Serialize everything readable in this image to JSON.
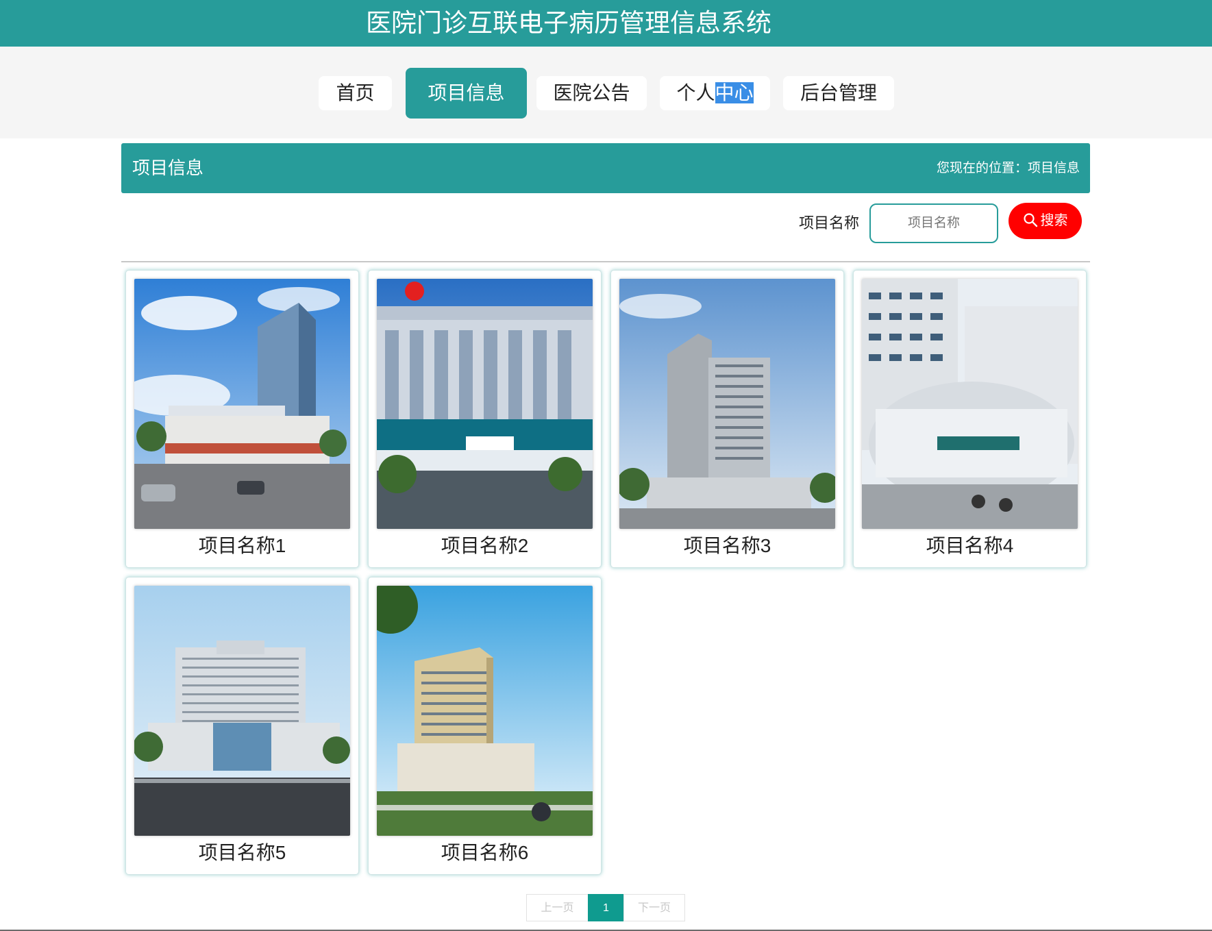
{
  "header": {
    "title": "医院门诊互联电子病历管理信息系统"
  },
  "nav": {
    "items": [
      {
        "label": "首页"
      },
      {
        "label": "项目信息"
      },
      {
        "label": "医院公告"
      },
      {
        "label": "个人",
        "label_highlight": "中心"
      },
      {
        "label": "后台管理"
      }
    ]
  },
  "section": {
    "title": "项目信息",
    "breadcrumb": "您现在的位置：项目信息"
  },
  "search": {
    "label": "项目名称",
    "placeholder": "项目名称",
    "button_label": "搜索",
    "button_icon": "search-icon"
  },
  "cards": [
    {
      "name": "项目名称1"
    },
    {
      "name": "项目名称2"
    },
    {
      "name": "项目名称3"
    },
    {
      "name": "项目名称4"
    },
    {
      "name": "项目名称5"
    },
    {
      "name": "项目名称6"
    }
  ],
  "pagination": {
    "prev": "上一页",
    "current": "1",
    "next": "下一页"
  },
  "colors": {
    "primary": "#279c9a",
    "search_button": "#ff0000",
    "active_page": "#0f9b8f",
    "highlight": "#3a8ee6"
  }
}
